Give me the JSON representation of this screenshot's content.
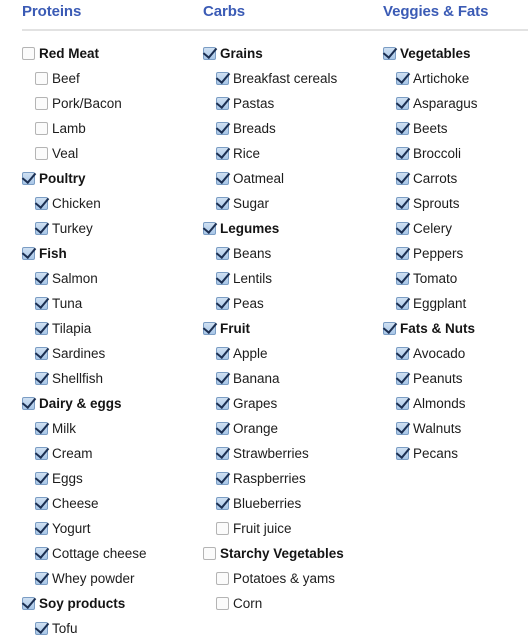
{
  "colors": {
    "header_text": "#3b5bb5",
    "rule": "#e2e2e2",
    "checkbox_checked_fill": "#a9c7e8",
    "checkbox_check_mark": "#1b2f52",
    "checkbox_unchecked_fill": "#fbfbfb",
    "label_text": "#1c1c1c"
  },
  "columns": [
    {
      "title": "Proteins",
      "groups": [
        {
          "label": "Red Meat",
          "checked": false,
          "children": [
            {
              "label": "Beef",
              "checked": false
            },
            {
              "label": "Pork/Bacon",
              "checked": false
            },
            {
              "label": "Lamb",
              "checked": false
            },
            {
              "label": "Veal",
              "checked": false
            }
          ]
        },
        {
          "label": "Poultry",
          "checked": true,
          "children": [
            {
              "label": "Chicken",
              "checked": true
            },
            {
              "label": "Turkey",
              "checked": true
            }
          ]
        },
        {
          "label": "Fish",
          "checked": true,
          "children": [
            {
              "label": "Salmon",
              "checked": true
            },
            {
              "label": "Tuna",
              "checked": true
            },
            {
              "label": "Tilapia",
              "checked": true
            },
            {
              "label": "Sardines",
              "checked": true
            },
            {
              "label": "Shellfish",
              "checked": true
            }
          ]
        },
        {
          "label": "Dairy & eggs",
          "checked": true,
          "children": [
            {
              "label": "Milk",
              "checked": true
            },
            {
              "label": "Cream",
              "checked": true
            },
            {
              "label": "Eggs",
              "checked": true
            },
            {
              "label": "Cheese",
              "checked": true
            },
            {
              "label": "Yogurt",
              "checked": true
            },
            {
              "label": "Cottage cheese",
              "checked": true
            },
            {
              "label": "Whey powder",
              "checked": true
            }
          ]
        },
        {
          "label": "Soy products",
          "checked": true,
          "children": [
            {
              "label": "Tofu",
              "checked": true
            }
          ]
        }
      ]
    },
    {
      "title": "Carbs",
      "groups": [
        {
          "label": "Grains",
          "checked": true,
          "children": [
            {
              "label": "Breakfast cereals",
              "checked": true
            },
            {
              "label": "Pastas",
              "checked": true
            },
            {
              "label": "Breads",
              "checked": true
            },
            {
              "label": "Rice",
              "checked": true
            },
            {
              "label": "Oatmeal",
              "checked": true
            },
            {
              "label": "Sugar",
              "checked": true
            }
          ]
        },
        {
          "label": "Legumes",
          "checked": true,
          "children": [
            {
              "label": "Beans",
              "checked": true
            },
            {
              "label": "Lentils",
              "checked": true
            },
            {
              "label": "Peas",
              "checked": true
            }
          ]
        },
        {
          "label": "Fruit",
          "checked": true,
          "children": [
            {
              "label": "Apple",
              "checked": true
            },
            {
              "label": "Banana",
              "checked": true
            },
            {
              "label": "Grapes",
              "checked": true
            },
            {
              "label": "Orange",
              "checked": true
            },
            {
              "label": "Strawberries",
              "checked": true
            },
            {
              "label": "Raspberries",
              "checked": true
            },
            {
              "label": "Blueberries",
              "checked": true
            },
            {
              "label": "Fruit juice",
              "checked": false
            }
          ]
        },
        {
          "label": "Starchy Vegetables",
          "checked": false,
          "children": [
            {
              "label": "Potatoes & yams",
              "checked": false
            },
            {
              "label": "Corn",
              "checked": false
            }
          ]
        }
      ]
    },
    {
      "title": "Veggies & Fats",
      "groups": [
        {
          "label": "Vegetables",
          "checked": true,
          "children": [
            {
              "label": "Artichoke",
              "checked": true
            },
            {
              "label": "Asparagus",
              "checked": true
            },
            {
              "label": "Beets",
              "checked": true
            },
            {
              "label": "Broccoli",
              "checked": true
            },
            {
              "label": "Carrots",
              "checked": true
            },
            {
              "label": "Sprouts",
              "checked": true
            },
            {
              "label": "Celery",
              "checked": true
            },
            {
              "label": "Peppers",
              "checked": true
            },
            {
              "label": "Tomato",
              "checked": true
            },
            {
              "label": "Eggplant",
              "checked": true
            }
          ]
        },
        {
          "label": "Fats & Nuts",
          "checked": true,
          "children": [
            {
              "label": "Avocado",
              "checked": true
            },
            {
              "label": "Peanuts",
              "checked": true
            },
            {
              "label": "Almonds",
              "checked": true
            },
            {
              "label": "Walnuts",
              "checked": true
            },
            {
              "label": "Pecans",
              "checked": true
            }
          ]
        }
      ]
    }
  ]
}
